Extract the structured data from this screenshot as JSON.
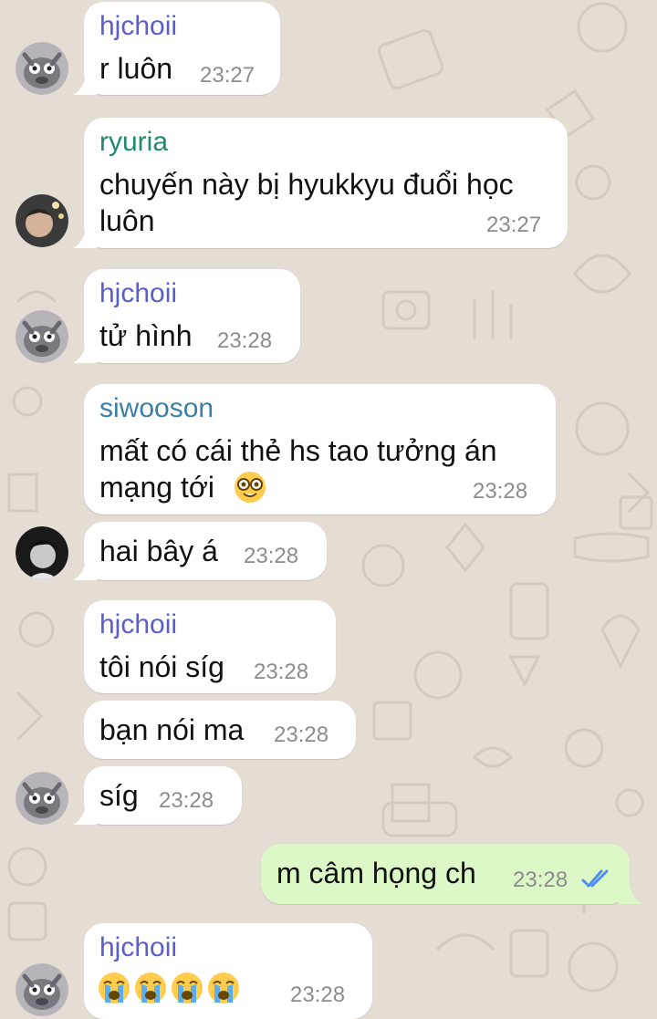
{
  "messages": [
    {
      "sender": "hjchoii",
      "lines": [
        "r luôn"
      ],
      "time": "23:27"
    },
    {
      "sender": "ryuria",
      "lines": [
        "chuyến này bị hyukkyu đuổi học",
        "luôn"
      ],
      "time": "23:27"
    },
    {
      "sender": "hjchoii",
      "lines": [
        "tử hình"
      ],
      "time": "23:28"
    },
    {
      "sender": "siwooson",
      "lines": [
        "mất có cái thẻ hs tao tưởng án",
        "mạng tới"
      ],
      "time": "23:28",
      "emoji": "nerd-face"
    },
    {
      "lines": [
        "hai bây á"
      ],
      "time": "23:28"
    },
    {
      "sender": "hjchoii",
      "lines": [
        "tôi nói síg"
      ],
      "time": "23:28"
    },
    {
      "lines": [
        "bạn nói ma"
      ],
      "time": "23:28"
    },
    {
      "lines": [
        "síg"
      ],
      "time": "23:28"
    },
    {
      "lines": [
        "m câm họng ch"
      ],
      "time": "23:28",
      "outgoing": true,
      "status": "read-double-check"
    },
    {
      "sender": "hjchoii",
      "emojis": [
        "loudly-crying-face",
        "loudly-crying-face",
        "loudly-crying-face",
        "loudly-crying-face"
      ],
      "time": "23:28"
    }
  ],
  "colors": {
    "hjchoii": "#5a5fc8",
    "ryuria": "#1f8a6e",
    "siwooson": "#3d7ea6",
    "read_check": "#4f8ef0",
    "outgoing_bubble": "#dcf8c6",
    "incoming_bubble": "#ffffff"
  }
}
